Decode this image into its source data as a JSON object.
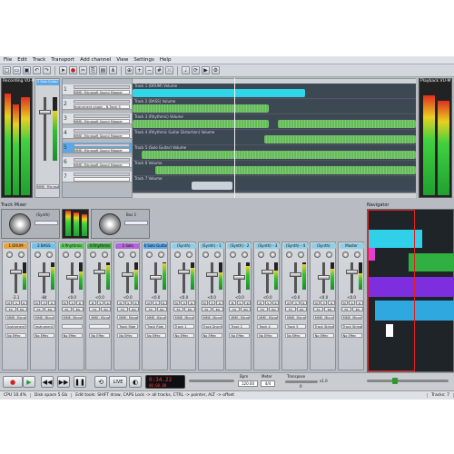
{
  "menu": [
    "File",
    "Edit",
    "Track",
    "Transport",
    "Add channel",
    "View",
    "Settings",
    "Help"
  ],
  "toolbar": {
    "icons": [
      "new-icon",
      "open-icon",
      "save-icon",
      "undo-icon",
      "redo-icon",
      "pointer-icon",
      "record-icon",
      "cut-icon",
      "copy-icon",
      "paste-icon",
      "split-icon",
      "glue-icon",
      "zoom-in-icon",
      "zoom-out-icon",
      "grid-icon",
      "crossfade-icon",
      "metronome-icon",
      "loop-icon",
      "playback-icon",
      "settings-icon"
    ]
  },
  "recording_meter": {
    "label": "Recording VU-M"
  },
  "playback_meter": {
    "label": "Playback VU-M"
  },
  "solo_strip": {
    "title": "5 Solo Guitar",
    "device": "MME: Microso"
  },
  "tracks": [
    {
      "num": "1",
      "name": "MME: Microsoft Sound Mapper",
      "lane": "Track 1 (DRUM) Volume"
    },
    {
      "num": "2",
      "name": "Instrument plugin - N-Track S",
      "lane": "Track 2 (BASS) Volume"
    },
    {
      "num": "3",
      "name": "MME: Microsoft Sound Mapper",
      "lane": "Track 3 (Rhythmic) Volume"
    },
    {
      "num": "4",
      "name": "MME: Microsoft Sound Mapper",
      "lane": "Track 4 (Rhythmic Guitar Distortion) Volume"
    },
    {
      "num": "5",
      "name": "MME: Microsoft Sound Mapper",
      "lane": "Track 5 (Solo Guitar) Volume"
    },
    {
      "num": "6",
      "name": "MME: Microsoft Sound Mapper",
      "lane": "Track 6 Volume"
    },
    {
      "num": "7",
      "name": "",
      "lane": "Track 7 Volume"
    }
  ],
  "panels": {
    "track_mixer": "Track Mixer",
    "navigator": "Navigator"
  },
  "mixer_strips": [
    {
      "title": "1 DRUM",
      "color": "#e7a43c",
      "value": "-2.1",
      "device": "MME: Microso",
      "fx": "No Effec",
      "send": "Instrument plu"
    },
    {
      "title": "2 BASS",
      "color": "#6fc3e8",
      "value": "-84",
      "device": "MME: Microso",
      "fx": "No Effec",
      "send": "Instrument plu"
    },
    {
      "title": "3 Rhythmic",
      "color": "#5ec85e",
      "value": "<0.0",
      "device": "MME: Microso",
      "fx": "No Effec",
      "send": ""
    },
    {
      "title": "4 Rhythmic",
      "color": "#4ab04a",
      "value": "<0.0",
      "device": "MME: Microso",
      "fx": "No Effec",
      "send": ""
    },
    {
      "title": "5 Solo",
      "color": "#b466d8",
      "value": "<0.0",
      "device": "MME: Microso",
      "fx": "No Effec",
      "send": "Track Ride"
    },
    {
      "title": "6 Solo Guitar",
      "color": "#5aa8e8",
      "value": "<0.0",
      "device": "MME: Microso",
      "fx": "No Effec",
      "send": "Track Ride"
    },
    {
      "title": "(Synth)",
      "color": "#8fd0e8",
      "value": "<0.0",
      "device": "MME: Microso",
      "fx": "No Effec",
      "send": "Track 1"
    },
    {
      "title": "(Synth) - 1",
      "color": "#8fd0e8",
      "value": "<0.0",
      "device": "MME: Microso",
      "fx": "No Effec",
      "send": "Track Drums"
    },
    {
      "title": "(Synth) - 2",
      "color": "#8fd0e8",
      "value": "<0.0",
      "device": "MME: Microso",
      "fx": "No Effec",
      "send": "Track 2"
    },
    {
      "title": "(Synth) - 3",
      "color": "#8fd0e8",
      "value": "<0.0",
      "device": "MME: Microso",
      "fx": "No Effec",
      "send": "Track 4"
    },
    {
      "title": "(Synth) - 4",
      "color": "#8fd0e8",
      "value": "<0.0",
      "device": "MME: Microso",
      "fx": "No Effec",
      "send": "Track 5"
    },
    {
      "title": "(Synth)",
      "color": "#8fd0e8",
      "value": "<0.0",
      "device": "MME: Microso",
      "fx": "No Effec",
      "send": "Track Strings"
    },
    {
      "title": "Master",
      "color": "#8fd0e8",
      "value": "<0.0",
      "device": "MME: Microso",
      "fx": "No Effec",
      "send": "Track Strings"
    }
  ],
  "knob_panels": [
    {
      "label": "(Synth)"
    },
    {
      "label": "Bus 1"
    }
  ],
  "navigator_colors": [
    "#2fd0e8",
    "#e040d0",
    "#30b040",
    "#7d2fe0",
    "#2fa8e0",
    "#ffffff"
  ],
  "transport": {
    "time": "0:34.22",
    "time_sub": "00:00.00",
    "live": "LIVE",
    "bpm_label": "Bpm",
    "bpm": "120.00",
    "meter_label": "Meter",
    "meter": "4/4",
    "transpose_label": "Transpose",
    "transpose": "0",
    "zoom": "x1.0"
  },
  "status": {
    "cpu": "CPU 10.4%",
    "disk": "Disk space 5 Gb",
    "hint": "Edit tools: SHIFT draw, CAPS Lock -> all tracks, CTRL -> pointer, ALT -> offset",
    "tracks": "Tracks: 7"
  }
}
